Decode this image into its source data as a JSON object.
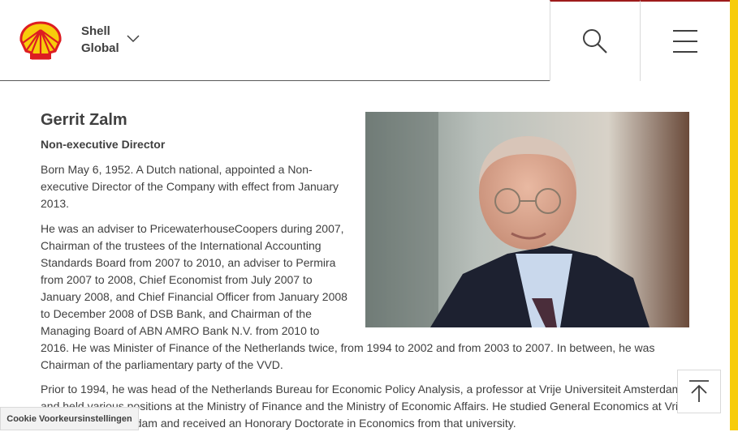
{
  "header": {
    "brand_line1": "Shell",
    "brand_line2": "Global"
  },
  "profile": {
    "name": "Gerrit Zalm",
    "role": "Non-executive Director",
    "para1": "Born May 6, 1952. A Dutch national, appointed a Non-executive Director of the Company with effect from January 2013.",
    "para2_lines": [
      "He was an adviser to PricewaterhouseCoopers during 2007,",
      "Chairman of the trustees of the International Accounting",
      "Standards Board from 2007 to 2010, an adviser to Permira",
      "from 2007 to 2008, Chief Economist from July 2007 to",
      "January 2008, and Chief Financial Officer from January 2008",
      "to December 2008 of DSB Bank, and Chairman of the",
      "Managing Board of ABN AMRO Bank N.V. from 2010 to",
      "2016. He was Minister of Finance of the Netherlands twice, from 1994 to 2002 and from 2003 to 2007. In between, he was",
      "Chairman of the parliamentary party of the VVD."
    ],
    "para3_lines": [
      "Prior to 1994, he was head of the Netherlands Bureau for Economic Policy Analysis, a professor at Vrije Universiteit Amsterdam",
      "and held various positions at the Ministry of Finance and the Ministry of Economic Affairs. He studied General Economics at Vrije",
      "Universiteit Amsterdam and received an Honorary Doctorate in Economics from that university."
    ]
  },
  "cookie_label": "Cookie Voorkeursinstellingen",
  "colors": {
    "brand_yellow": "#f7cc0b",
    "brand_red": "#dd1d21",
    "text": "#404040"
  },
  "icons": [
    "shell-logo",
    "chevron-down-icon",
    "search-icon",
    "menu-icon",
    "arrow-up-icon"
  ]
}
